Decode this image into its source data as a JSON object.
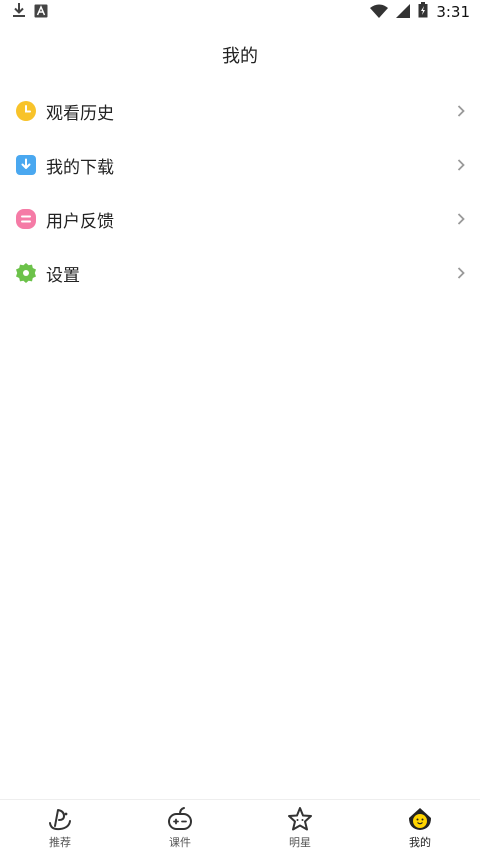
{
  "status_bar": {
    "time": "3:31",
    "left_icons": [
      "download-icon",
      "a-notification-icon"
    ],
    "right_icons": [
      "wifi-icon",
      "signal-icon",
      "battery-charging-icon"
    ]
  },
  "header": {
    "title": "我的"
  },
  "menu": {
    "items": [
      {
        "label": "观看历史",
        "icon": "clock-icon",
        "color": "#F8C32A"
      },
      {
        "label": "我的下载",
        "icon": "download-box-icon",
        "color": "#4AA8F0"
      },
      {
        "label": "用户反馈",
        "icon": "feedback-icon",
        "color": "#F57BA6"
      },
      {
        "label": "设置",
        "icon": "settings-gear-icon",
        "color": "#6CC24A"
      }
    ]
  },
  "bottom_nav": {
    "items": [
      {
        "label": "推荐",
        "icon": "recommend-icon",
        "active": false
      },
      {
        "label": "课件",
        "icon": "courseware-icon",
        "active": false
      },
      {
        "label": "明星",
        "icon": "star-icon",
        "active": false
      },
      {
        "label": "我的",
        "icon": "mine-icon",
        "active": true
      }
    ],
    "active_color": "#FFD400"
  }
}
